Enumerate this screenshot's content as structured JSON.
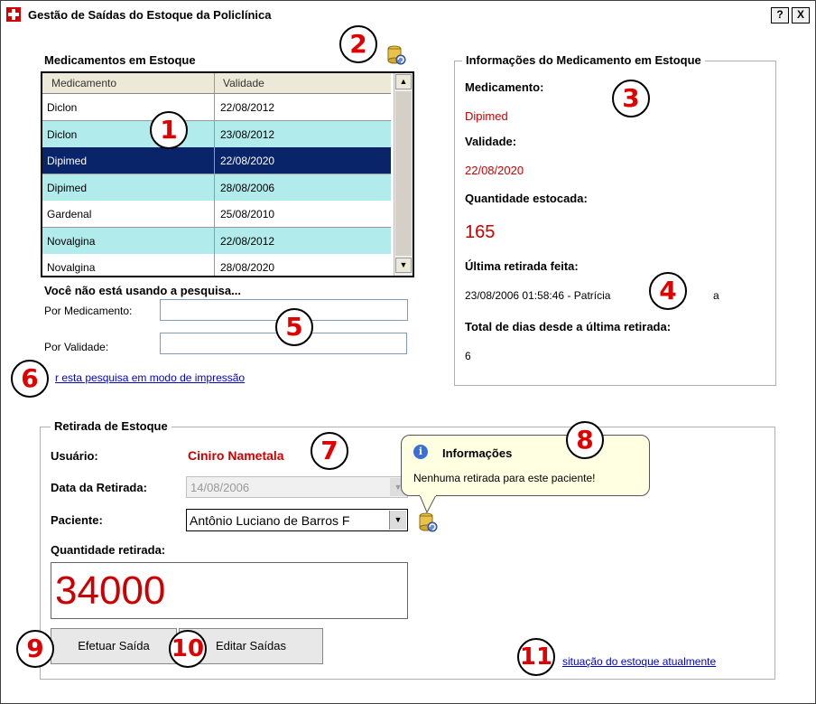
{
  "window": {
    "title": "Gestão de Saídas do Estoque da Policlínica",
    "help_label": "?",
    "close_label": "X"
  },
  "stock": {
    "title": "Medicamentos em Estoque",
    "columns": [
      "Medicamento",
      "Validade"
    ],
    "rows": [
      {
        "med": "Diclon",
        "val": "22/08/2012"
      },
      {
        "med": "Diclon",
        "val": "23/08/2012"
      },
      {
        "med": "Dipimed",
        "val": "22/08/2020"
      },
      {
        "med": "Dipimed",
        "val": "28/08/2006"
      },
      {
        "med": "Gardenal",
        "val": "25/08/2010"
      },
      {
        "med": "Novalgina",
        "val": "22/08/2012"
      },
      {
        "med": "Novalgina",
        "val": "28/08/2020"
      }
    ],
    "selected_index": 2,
    "row_colors": {
      "even": "#ffffff",
      "odd": "#b2ebeb",
      "selected": "#0a246a"
    }
  },
  "search": {
    "status": "Você não está usando a pesquisa...",
    "by_med_label": "Por Medicamento:",
    "by_med_value": "",
    "by_val_label": "Por Validade:",
    "by_val_value": "",
    "print_link": "r esta pesquisa em modo de impressão"
  },
  "info": {
    "legend": "Informações do Medicamento em Estoque",
    "med_label": "Medicamento:",
    "med_value": "Dipimed",
    "val_label": "Validade:",
    "val_value": "22/08/2020",
    "qty_label": "Quantidade estocada:",
    "qty_value": "165",
    "last_label": "Última retirada feita:",
    "last_value_a": "23/08/2006 01:58:46 - Patrícia",
    "last_value_b": "a",
    "days_label": "Total de dias desde a última retirada:",
    "days_value": "6"
  },
  "withdraw": {
    "legend": "Retirada de Estoque",
    "user_label": "Usuário:",
    "user_value": "Ciniro Nametala",
    "date_label": "Data da Retirada:",
    "date_value": "14/08/2006",
    "patient_label": "Paciente:",
    "patient_value": "Antônio Luciano de Barros F",
    "qty_label": "Quantidade retirada:",
    "qty_value": "34000",
    "btn_saida": "Efetuar Saída",
    "btn_editar": "Editar Saídas",
    "status_link": "situação do estoque atualmente"
  },
  "tooltip": {
    "title": "Informações",
    "message": "Nenhuma retirada para este paciente!"
  },
  "badges": [
    "1",
    "2",
    "3",
    "4",
    "5",
    "6",
    "7",
    "8",
    "9",
    "10",
    "11"
  ],
  "colors": {
    "accent_red": "#cc0000",
    "badge_red": "#e00000",
    "link_blue": "#0000cc"
  }
}
